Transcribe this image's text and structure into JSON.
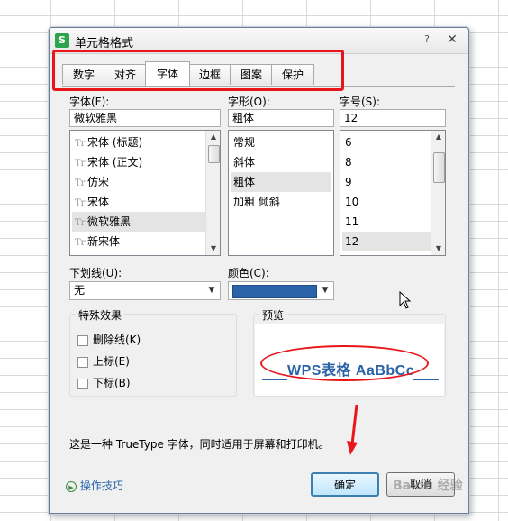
{
  "dialog": {
    "title": "单元格格式",
    "app_icon": "S",
    "help": "?",
    "close": "✕"
  },
  "tabs": [
    {
      "label": "数字"
    },
    {
      "label": "对齐"
    },
    {
      "label": "字体"
    },
    {
      "label": "边框"
    },
    {
      "label": "图案"
    },
    {
      "label": "保护"
    }
  ],
  "font": {
    "label": "字体(F):",
    "value": "微软雅黑",
    "items": [
      "宋体 (标题)",
      "宋体 (正文)",
      "仿宋",
      "宋体",
      "微软雅黑",
      "新宋体"
    ],
    "selected": "微软雅黑"
  },
  "style": {
    "label": "字形(O):",
    "value": "粗体",
    "items": [
      "常规",
      "斜体",
      "粗体",
      "加粗 倾斜"
    ],
    "selected": "粗体"
  },
  "size": {
    "label": "字号(S):",
    "value": "12",
    "items": [
      "6",
      "8",
      "9",
      "10",
      "11",
      "12"
    ],
    "selected": "12"
  },
  "underline": {
    "label": "下划线(U):",
    "value": "无"
  },
  "color": {
    "label": "颜色(C):",
    "value_hex": "#2a63a8"
  },
  "effects": {
    "title": "特殊效果",
    "strikethrough": "删除线(K)",
    "superscript": "上标(E)",
    "subscript": "下标(B)"
  },
  "preview": {
    "title": "预览",
    "text": "WPS表格  AaBbCc"
  },
  "description": "这是一种 TrueType 字体，同时适用于屏幕和打印机。",
  "footer": {
    "tips": "操作技巧",
    "ok": "确定",
    "cancel": "取消"
  },
  "watermark": "Baidu 经验",
  "colors": {
    "accent": "#2a63a8",
    "annotation_red": "#e8161b"
  }
}
